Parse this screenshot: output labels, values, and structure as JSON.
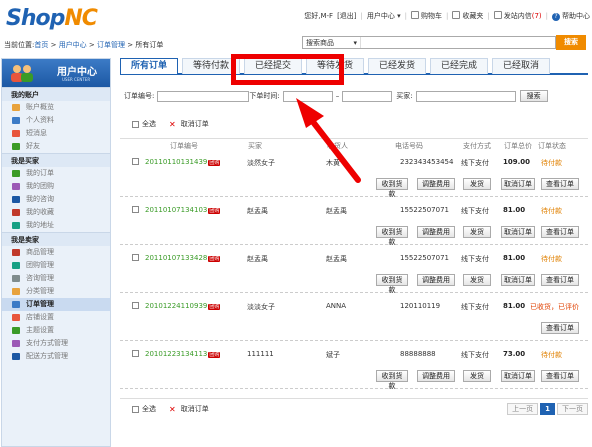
{
  "brand": {
    "logo_part1": "Shop",
    "logo_part2": "NC"
  },
  "toplinks": {
    "greeting": "您好,M-F",
    "logout": "[退出]",
    "user_center": "用户中心",
    "cart": "购物车",
    "favorites": "收藏夹",
    "inbox": "发站内信",
    "inbox_count": "(7)",
    "help": "帮助中心"
  },
  "breadcrumb": {
    "prefix": "当前位置:",
    "home": "首页",
    "sep": " > ",
    "user_center": "用户中心",
    "orders": "订单管理",
    "current": "所有订单"
  },
  "search": {
    "scope": "搜索商品",
    "button": "搜索"
  },
  "sidebar": {
    "title": "用户中心",
    "subtitle": "USER CENTER",
    "sections": [
      {
        "title": "我的账户",
        "items": [
          "账户概览",
          "个人资料",
          "短消息",
          "好友"
        ]
      },
      {
        "title": "我是买家",
        "items": [
          "我的订单",
          "我的团购",
          "我的咨询",
          "我的收藏",
          "我的地址"
        ]
      },
      {
        "title": "我是卖家",
        "items": [
          "商品管理",
          "团购管理",
          "咨询管理",
          "分类管理",
          "订单管理",
          "店铺设置",
          "主题设置",
          "支付方式管理",
          "配送方式管理"
        ]
      }
    ]
  },
  "tabs": [
    "所有订单",
    "等待付款",
    "已经提交",
    "等待发货",
    "已经发货",
    "已经完成",
    "已经取消"
  ],
  "filter": {
    "order_no_label": "订单编号:",
    "time_label": "下单时间:",
    "dash": "–",
    "buyer_label": "买家:",
    "search_button": "搜索"
  },
  "bulk": {
    "select_all": "全选",
    "cancel_order": "取消订单"
  },
  "table_headers": [
    "订单编号",
    "买家",
    "收货人",
    "电话号码",
    "支付方式",
    "订单总价",
    "订单状态"
  ],
  "orders": [
    {
      "no": "20110110131439",
      "tag": "团购",
      "buyer": "淡然女子",
      "receiver": "木黄",
      "phone": "232343453454",
      "pay": "线下支付",
      "total": "109.00",
      "status": "待付款",
      "actions": [
        "收到货款",
        "调整费用",
        "发货",
        "取消订单",
        "查看订单"
      ]
    },
    {
      "no": "20110107134103",
      "tag": "团购",
      "buyer": "赵孟禹",
      "receiver": "赵孟禹",
      "phone": "15522507071",
      "pay": "线下支付",
      "total": "81.00",
      "status": "待付款",
      "actions": [
        "收到货款",
        "调整费用",
        "发货",
        "取消订单",
        "查看订单"
      ]
    },
    {
      "no": "20110107133428",
      "tag": "团购",
      "buyer": "赵孟禹",
      "receiver": "赵孟禹",
      "phone": "15522507071",
      "pay": "线下支付",
      "total": "81.00",
      "status": "待付款",
      "actions": [
        "收到货款",
        "调整费用",
        "发货",
        "取消订单",
        "查看订单"
      ]
    },
    {
      "no": "20101224110939",
      "tag": "团购",
      "buyer": "淡淡女子",
      "receiver": "ANNA",
      "phone": "120110119",
      "pay": "线下支付",
      "total": "81.00",
      "status": "已收货，已评价",
      "actions": [
        "查看订单"
      ]
    },
    {
      "no": "20101223134113",
      "tag": "团购",
      "buyer": "111111",
      "receiver": "斌子",
      "phone": "88888888",
      "pay": "线下支付",
      "total": "73.00",
      "status": "待付款",
      "actions": [
        "收到货款",
        "调整费用",
        "发货",
        "取消订单",
        "查看订单"
      ]
    }
  ],
  "pager": {
    "prev": "上一页",
    "current": "1",
    "next": "下一页"
  },
  "colors": {
    "brand_blue": "#1f62b2",
    "brand_orange": "#f08b00",
    "annotation_red": "#e00000"
  }
}
